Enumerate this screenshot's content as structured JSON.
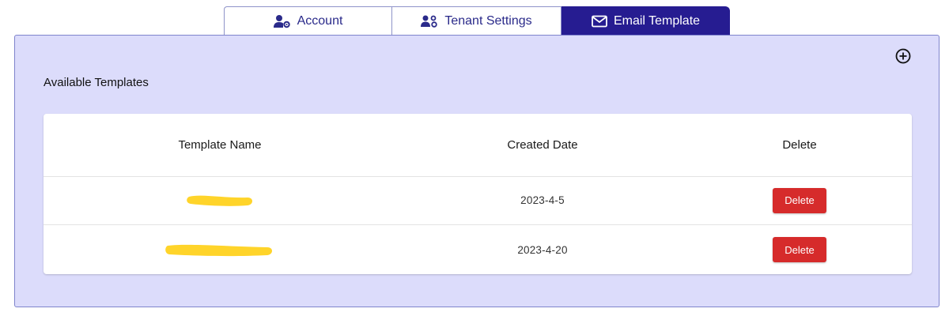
{
  "tabs": [
    {
      "label": "Account",
      "icon": "user-gear-icon",
      "active": false
    },
    {
      "label": "Tenant Settings",
      "icon": "users-gear-icon",
      "active": false
    },
    {
      "label": "Email Template",
      "icon": "envelope-icon",
      "active": true
    }
  ],
  "panel": {
    "title": "Available Templates",
    "add_icon": "plus-circle-icon"
  },
  "table": {
    "headers": [
      "Template Name",
      "Created Date",
      "Delete"
    ],
    "rows": [
      {
        "name": "",
        "created": "2023-4-5",
        "action": "Delete"
      },
      {
        "name": "",
        "created": "2023-4-20",
        "action": "Delete"
      }
    ]
  },
  "colors": {
    "accent": "#261c91",
    "panel_bg": "#dcdcfb",
    "delete": "#d62b2b",
    "redaction": "#ffd42a"
  }
}
